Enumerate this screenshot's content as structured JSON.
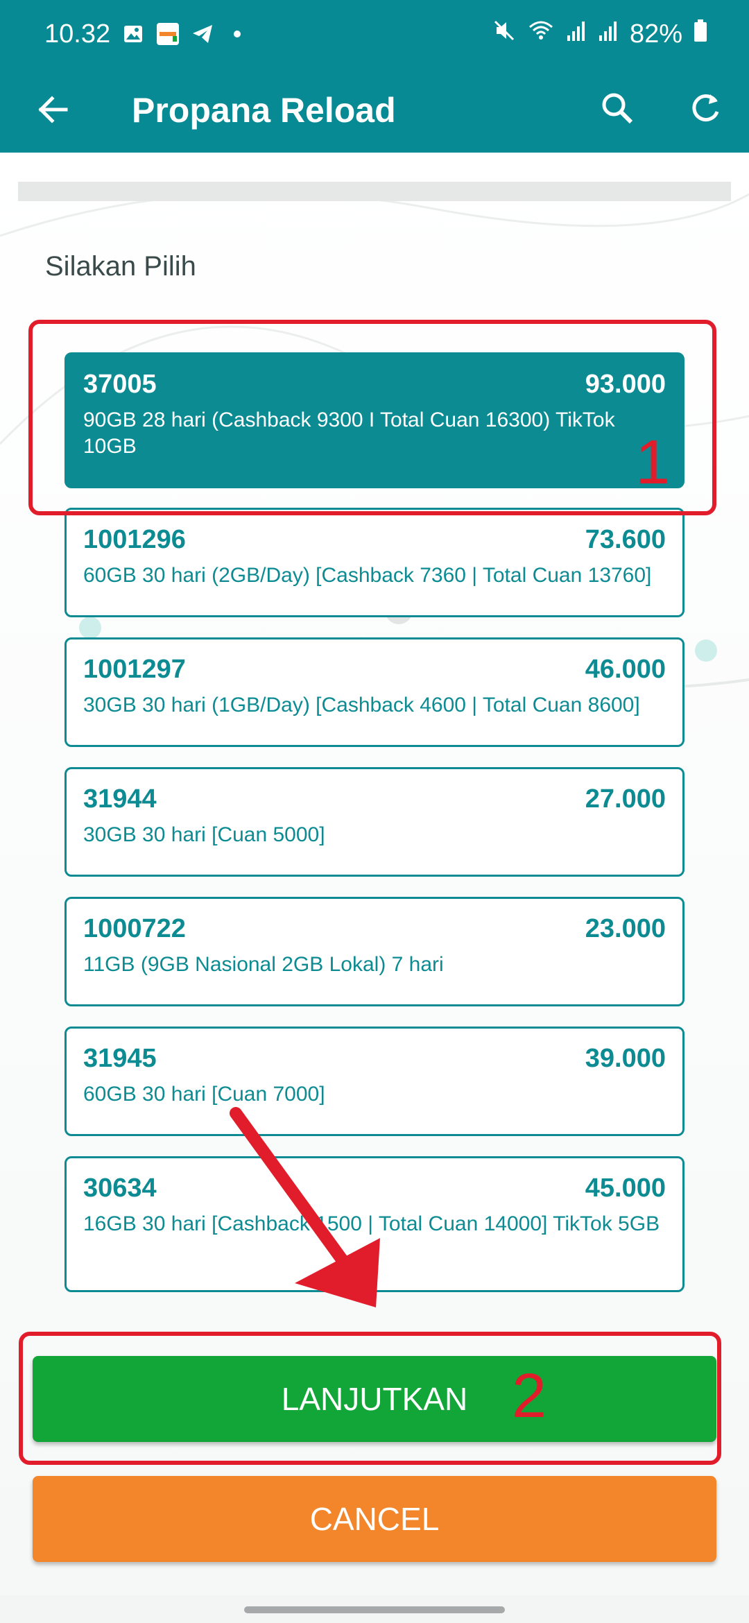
{
  "status_bar": {
    "time": "10.32",
    "battery": "82%",
    "icons": [
      "image-icon",
      "propana-app-icon",
      "telegram-icon",
      "dot-icon",
      "mute-icon",
      "wifi-icon",
      "signal-icon",
      "signal-icon",
      "battery-icon"
    ]
  },
  "app_bar": {
    "title": "Propana Reload",
    "icons": [
      "back-arrow-icon",
      "search-icon",
      "refresh-icon"
    ]
  },
  "list": {
    "heading": "Silakan Pilih",
    "items": [
      {
        "code": "37005",
        "price": "93.000",
        "description": "90GB 28 hari (Cashback 9300 I Total Cuan 16300) TikTok 10GB",
        "selected": true
      },
      {
        "code": "1001296",
        "price": "73.600",
        "description": "60GB 30 hari (2GB/Day) [Cashback 7360 | Total Cuan 13760]",
        "selected": false
      },
      {
        "code": "1001297",
        "price": "46.000",
        "description": "30GB 30 hari (1GB/Day) [Cashback 4600 | Total Cuan 8600]",
        "selected": false
      },
      {
        "code": "31944",
        "price": "27.000",
        "description": "30GB 30 hari [Cuan 5000]",
        "selected": false
      },
      {
        "code": "1000722",
        "price": "23.000",
        "description": "11GB (9GB Nasional 2GB Lokal) 7 hari",
        "selected": false
      },
      {
        "code": "31945",
        "price": "39.000",
        "description": "60GB 30 hari [Cuan 7000]",
        "selected": false
      },
      {
        "code": "30634",
        "price": "45.000",
        "description": "16GB 30 hari [Cashback 1500 | Total Cuan 14000] TikTok 5GB",
        "selected": false
      }
    ]
  },
  "buttons": {
    "continue": "LANJUTKAN",
    "cancel": "CANCEL"
  },
  "annotations": {
    "step1": "1",
    "step2": "2"
  },
  "colors": {
    "primary": "#078a94",
    "accent_green": "#12a538",
    "accent_orange": "#f3852a",
    "annotation_red": "#e21d2b"
  }
}
